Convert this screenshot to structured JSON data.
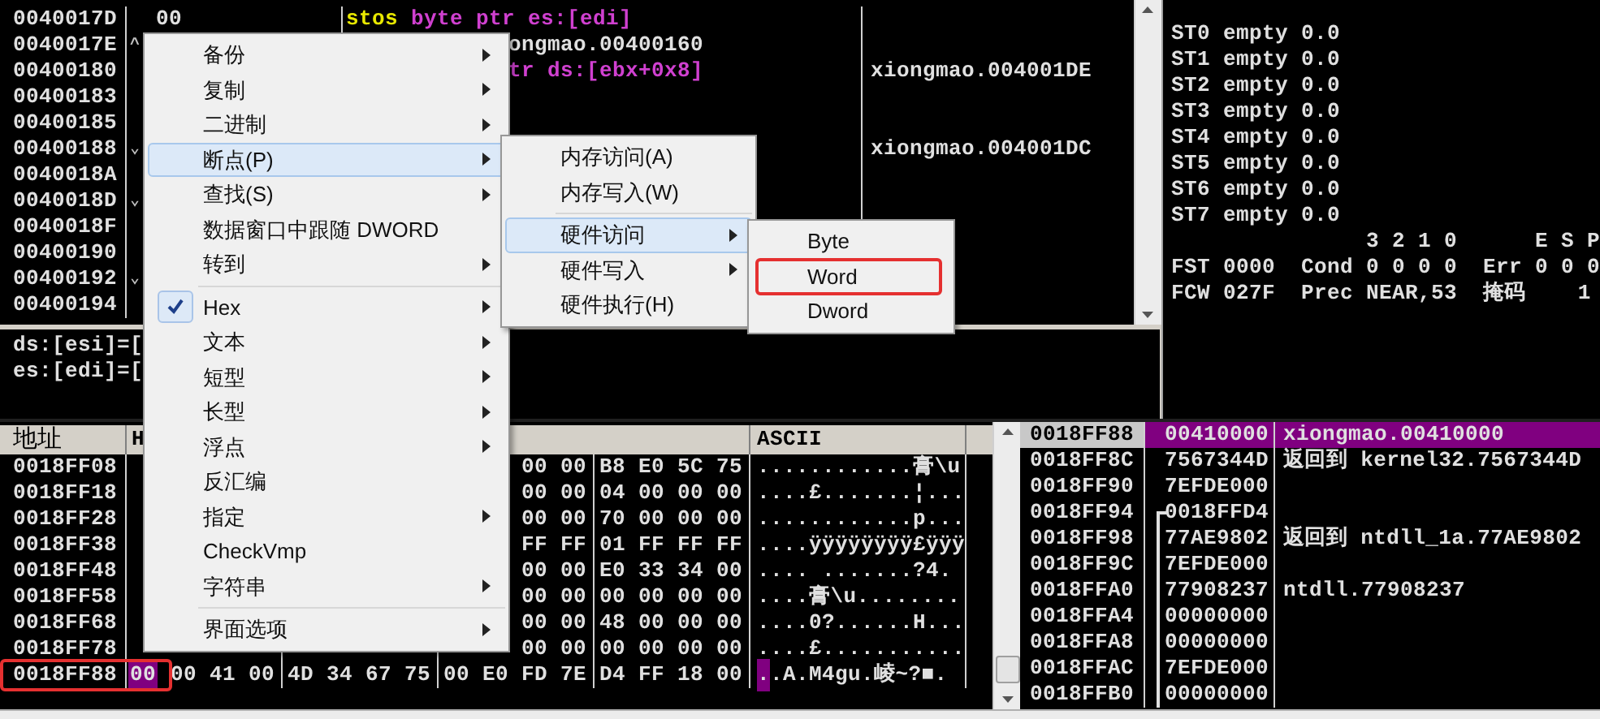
{
  "cpu": {
    "rows": [
      {
        "address": "0040017D",
        "hex": "00",
        "disasm": [
          {
            "text": "stos",
            "kind": "string_op"
          },
          {
            "text": "byte ptr es:[edi]",
            "kind": "memory"
          }
        ]
      },
      {
        "address": "0040017E",
        "marker": "^",
        "disasm": [
          {
            "text": "ongmao.00400160",
            "kind": "plain"
          }
        ]
      },
      {
        "address": "00400180",
        "disasm": [
          {
            "text": "tr ds:[ebx+0x8]",
            "kind": "memory"
          }
        ],
        "comment": "xiongmao.004001DE"
      },
      {
        "address": "00400183"
      },
      {
        "address": "00400185"
      },
      {
        "address": "00400188",
        "marker": "⌄",
        "comment": "xiongmao.004001DC"
      },
      {
        "address": "0040018A"
      },
      {
        "address": "0040018D",
        "marker": "⌄"
      },
      {
        "address": "0040018F"
      },
      {
        "address": "00400190"
      },
      {
        "address": "00400192",
        "marker": "⌄"
      },
      {
        "address": "00400194"
      }
    ]
  },
  "info": {
    "lines": [
      "ds:[esi]=[",
      "es:[edi]=["
    ]
  },
  "registers": {
    "lines": [
      "ST0 empty 0.0",
      "ST1 empty 0.0",
      "ST2 empty 0.0",
      "ST3 empty 0.0",
      "ST4 empty 0.0",
      "ST5 empty 0.0",
      "ST6 empty 0.0",
      "ST7 empty 0.0",
      "               3 2 1 0      E S P",
      "FST 0000  Cond 0 0 0 0  Err 0 0 0",
      "FCW 027F  Prec NEAR,53  掩码    1"
    ]
  },
  "dump": {
    "columns": [
      "地址",
      "H",
      "ASCII"
    ],
    "rows": [
      {
        "address": "0018FF08",
        "hex": [
          "00 00",
          "B8 E0 5C 75"
        ],
        "ascii": "............膏\\u",
        "outlined": false
      },
      {
        "address": "0018FF18",
        "hex": [
          "00 00",
          "04 00 00 00"
        ],
        "ascii": "....£.......¦...",
        "outlined": false
      },
      {
        "address": "0018FF28",
        "hex": [
          "00 00",
          "70 00 00 00"
        ],
        "ascii": "............p...",
        "outlined": false
      },
      {
        "address": "0018FF38",
        "hex": [
          "FF FF",
          "01 FF FF FF"
        ],
        "ascii": "....ÿÿÿÿÿÿÿÿ£ÿÿÿ",
        "outlined": false
      },
      {
        "address": "0018FF48",
        "hex": [
          "00 00",
          "E0 33 34 00"
        ],
        "ascii": ".... .......?4.",
        "outlined": false
      },
      {
        "address": "0018FF58",
        "hex": [
          "00 00",
          "00 00 00 00"
        ],
        "ascii": "....膏\\u........",
        "outlined": false
      },
      {
        "address": "0018FF68",
        "hex": [
          "00 00",
          "48 00 00 00"
        ],
        "ascii": "....0?......H...",
        "outlined": false
      },
      {
        "address": "0018FF78",
        "hex": [
          "00 00",
          "00 00 00 00"
        ],
        "ascii": "....£...........",
        "outlined": false
      },
      {
        "address": "0018FF88",
        "cursor_byte": "00",
        "hex": [
          "00 41 00",
          "4D 34 67 75",
          "00 E0 FD 7E",
          "D4 FF 18 00"
        ],
        "cursor_char": ".",
        "ascii": ".A.M4gu.崚~?■.",
        "outlined": true
      }
    ]
  },
  "stack": {
    "rows": [
      {
        "address": "0018FF88",
        "value": "00410000",
        "comment": "xiongmao.00410000",
        "kind": "plain",
        "selected": true
      },
      {
        "address": "0018FF8C",
        "value": "7567344D",
        "comment": "返回到 kernel32.7567344D",
        "kind": "plain",
        "selected": false
      },
      {
        "address": "0018FF90",
        "value": "7EFDE000",
        "kind": "plain",
        "selected": false
      },
      {
        "address": "0018FF94",
        "value": "0018FFD4",
        "kind": "frame_start",
        "selected": false
      },
      {
        "address": "0018FF98",
        "value": "77AE9802",
        "comment": "返回到 ntdll_1a.77AE9802",
        "kind": "in_frame",
        "selected": false
      },
      {
        "address": "0018FF9C",
        "value": "7EFDE000",
        "kind": "in_frame",
        "selected": false
      },
      {
        "address": "0018FFA0",
        "value": "77908237",
        "comment": "ntdll.77908237",
        "kind": "in_frame",
        "selected": false
      },
      {
        "address": "0018FFA4",
        "value": "00000000",
        "kind": "in_frame",
        "selected": false
      },
      {
        "address": "0018FFA8",
        "value": "00000000",
        "kind": "in_frame",
        "selected": false
      },
      {
        "address": "0018FFAC",
        "value": "7EFDE000",
        "kind": "in_frame",
        "selected": false
      },
      {
        "address": "0018FFB0",
        "value": "00000000",
        "kind": "in_frame",
        "selected": false
      }
    ]
  },
  "context_menu": {
    "items": [
      {
        "kind": "item",
        "label": "备份",
        "submenu": true,
        "selected": false,
        "checked": false
      },
      {
        "kind": "item",
        "label": "复制",
        "submenu": true,
        "selected": false,
        "checked": false
      },
      {
        "kind": "item",
        "label": "二进制",
        "submenu": true,
        "selected": false,
        "checked": false
      },
      {
        "kind": "item",
        "label": "断点(P)",
        "submenu": true,
        "selected": true,
        "checked": false
      },
      {
        "kind": "item",
        "label": "查找(S)",
        "submenu": true,
        "selected": false,
        "checked": false
      },
      {
        "kind": "item",
        "label": "数据窗口中跟随 DWORD",
        "submenu": false,
        "selected": false,
        "checked": false
      },
      {
        "kind": "item",
        "label": "转到",
        "submenu": true,
        "selected": false,
        "checked": false
      },
      {
        "kind": "separator"
      },
      {
        "kind": "item",
        "label": "Hex",
        "submenu": true,
        "selected": false,
        "checked": true
      },
      {
        "kind": "item",
        "label": "文本",
        "submenu": true,
        "selected": false,
        "checked": false
      },
      {
        "kind": "item",
        "label": "短型",
        "submenu": true,
        "selected": false,
        "checked": false
      },
      {
        "kind": "item",
        "label": "长型",
        "submenu": true,
        "selected": false,
        "checked": false
      },
      {
        "kind": "item",
        "label": "浮点",
        "submenu": true,
        "selected": false,
        "checked": false
      },
      {
        "kind": "item",
        "label": "反汇编",
        "submenu": false,
        "selected": false,
        "checked": false
      },
      {
        "kind": "item",
        "label": "指定",
        "submenu": true,
        "selected": false,
        "checked": false
      },
      {
        "kind": "item",
        "label": "CheckVmp",
        "submenu": false,
        "selected": false,
        "checked": false
      },
      {
        "kind": "item",
        "label": "字符串",
        "submenu": true,
        "selected": false,
        "checked": false
      },
      {
        "kind": "separator"
      },
      {
        "kind": "item",
        "label": "界面选项",
        "submenu": true,
        "selected": false,
        "checked": false
      }
    ]
  },
  "breakpoint_menu": {
    "items": [
      {
        "kind": "item",
        "label": "内存访问(A)",
        "submenu": false,
        "selected": false,
        "checked": false
      },
      {
        "kind": "item",
        "label": "内存写入(W)",
        "submenu": false,
        "selected": false,
        "checked": false
      },
      {
        "kind": "separator"
      },
      {
        "kind": "item",
        "label": "硬件访问",
        "submenu": true,
        "selected": true,
        "checked": false
      },
      {
        "kind": "item",
        "label": "硬件写入",
        "submenu": true,
        "selected": false,
        "checked": false
      },
      {
        "kind": "item",
        "label": "硬件执行(H)",
        "submenu": false,
        "selected": false,
        "checked": false
      }
    ]
  },
  "size_menu": {
    "items": [
      {
        "kind": "item",
        "label": "Byte",
        "submenu": false,
        "selected": false,
        "checked": false,
        "outlined": false
      },
      {
        "kind": "item",
        "label": "Word",
        "submenu": false,
        "selected": false,
        "checked": false,
        "outlined": true
      },
      {
        "kind": "item",
        "label": "Dword",
        "submenu": false,
        "selected": false,
        "checked": false,
        "outlined": false
      }
    ]
  }
}
